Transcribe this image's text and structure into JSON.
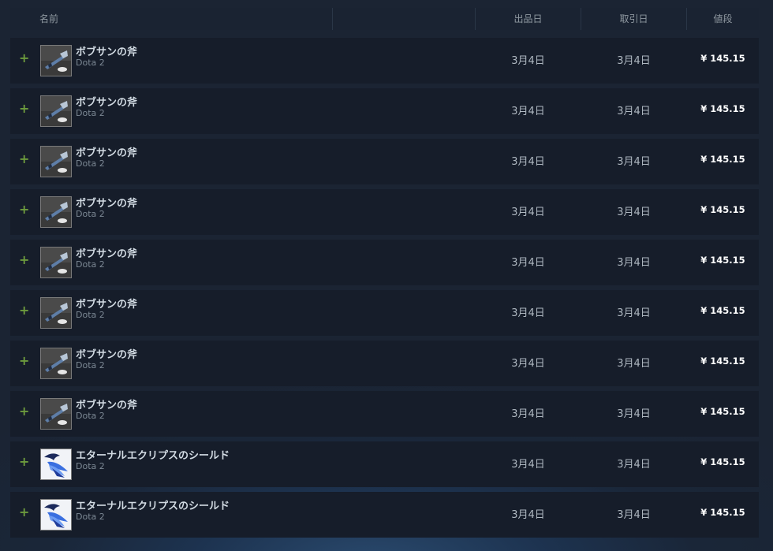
{
  "header": {
    "name": "名前",
    "listed_on": "出品日",
    "acted_on": "取引日",
    "price": "値段"
  },
  "rows": [
    {
      "name": "ボブサンの斧",
      "game": "Dota 2",
      "listed": "3月4日",
      "acted": "3月4日",
      "price": "¥ 145.15",
      "icon": "axe-icon"
    },
    {
      "name": "ボブサンの斧",
      "game": "Dota 2",
      "listed": "3月4日",
      "acted": "3月4日",
      "price": "¥ 145.15",
      "icon": "axe-icon"
    },
    {
      "name": "ボブサンの斧",
      "game": "Dota 2",
      "listed": "3月4日",
      "acted": "3月4日",
      "price": "¥ 145.15",
      "icon": "axe-icon"
    },
    {
      "name": "ボブサンの斧",
      "game": "Dota 2",
      "listed": "3月4日",
      "acted": "3月4日",
      "price": "¥ 145.15",
      "icon": "axe-icon"
    },
    {
      "name": "ボブサンの斧",
      "game": "Dota 2",
      "listed": "3月4日",
      "acted": "3月4日",
      "price": "¥ 145.15",
      "icon": "axe-icon"
    },
    {
      "name": "ボブサンの斧",
      "game": "Dota 2",
      "listed": "3月4日",
      "acted": "3月4日",
      "price": "¥ 145.15",
      "icon": "axe-icon"
    },
    {
      "name": "ボブサンの斧",
      "game": "Dota 2",
      "listed": "3月4日",
      "acted": "3月4日",
      "price": "¥ 145.15",
      "icon": "axe-icon"
    },
    {
      "name": "ボブサンの斧",
      "game": "Dota 2",
      "listed": "3月4日",
      "acted": "3月4日",
      "price": "¥ 145.15",
      "icon": "axe-icon"
    },
    {
      "name": "エターナルエクリプスのシールド",
      "game": "Dota 2",
      "listed": "3月4日",
      "acted": "3月4日",
      "price": "¥ 145.15",
      "icon": "shield-icon"
    },
    {
      "name": "エターナルエクリプスのシールド",
      "game": "Dota 2",
      "listed": "3月4日",
      "acted": "3月4日",
      "price": "¥ 145.15",
      "icon": "shield-icon"
    }
  ],
  "expand_symbol": "+",
  "colors": {
    "plus": "#6c9a3d",
    "row_bg": "#161d2a",
    "header_bg": "#1a2332",
    "price": "#ffffff"
  }
}
